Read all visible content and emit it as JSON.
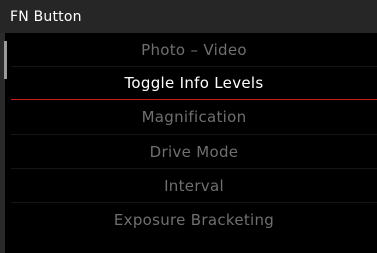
{
  "header": {
    "title": "FN Button"
  },
  "menu": {
    "selected_index": 1,
    "items": [
      {
        "label": "Photo – Video"
      },
      {
        "label": "Toggle Info Levels"
      },
      {
        "label": "Magnification"
      },
      {
        "label": "Drive Mode"
      },
      {
        "label": "Interval"
      },
      {
        "label": "Exposure Bracketing"
      }
    ]
  },
  "colors": {
    "background": "#000000",
    "title_bar": "#262626",
    "selected_text": "#ffffff",
    "inactive_text": "#6f6f6f",
    "selection_underline": "#c8201c"
  }
}
